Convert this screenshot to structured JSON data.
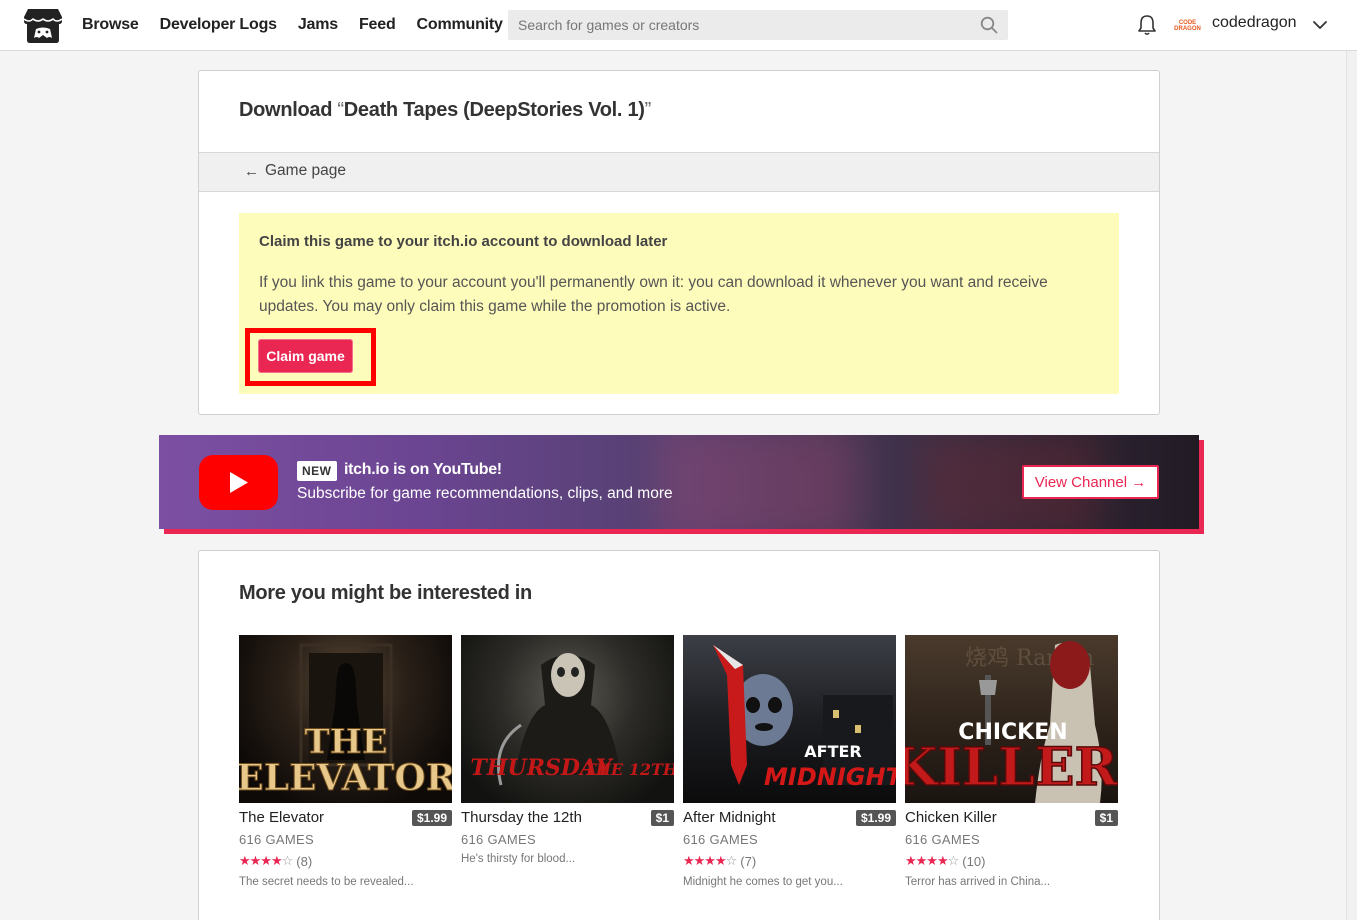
{
  "header": {
    "nav": [
      "Browse",
      "Developer Logs",
      "Jams",
      "Feed",
      "Community"
    ],
    "search_placeholder": "Search for games or creators",
    "avatar_text": "CODE DRAGON",
    "username": "codedragon"
  },
  "download": {
    "title_prefix": "Download ",
    "open_quote": "“",
    "game_name": "Death Tapes (DeepStories Vol. 1)",
    "close_quote": "”",
    "back_link": "Game page",
    "claim": {
      "title": "Claim this game to your itch.io account to download later",
      "description": "If you link this game to your account you'll permanently own it: you can download it whenever you want and receive updates. You may only claim this game while the promotion is active.",
      "button": "Claim game"
    }
  },
  "youtube_banner": {
    "badge": "NEW",
    "headline": "itch.io is on YouTube!",
    "subtitle": "Subscribe for game recommendations, clips, and more",
    "button": "View Channel →"
  },
  "recommendations": {
    "title": "More you might be interested in",
    "games": [
      {
        "title": "The Elevator",
        "price": "$1.99",
        "author": "616 GAMES",
        "rating": 4,
        "rating_count": "(8)",
        "description": "The secret needs to be revealed...",
        "thumb_text": "THE ELEVATOR"
      },
      {
        "title": "Thursday the 12th",
        "price": "$1",
        "author": "616 GAMES",
        "rating": null,
        "rating_count": "",
        "description": "He's thirsty for blood...",
        "thumb_text": "THURSDAY THE 12TH"
      },
      {
        "title": "After Midnight",
        "price": "$1.99",
        "author": "616 GAMES",
        "rating": 4,
        "rating_count": "(7)",
        "description": "Midnight he comes to get you...",
        "thumb_text": "AFTER MIDNIGHT"
      },
      {
        "title": "Chicken Killer",
        "price": "$1",
        "author": "616 GAMES",
        "rating": 4,
        "rating_count": "(10)",
        "description": "Terror has arrived in China...",
        "thumb_text": "CHICKEN KILLER"
      }
    ]
  },
  "colors": {
    "accent": "#ea2653",
    "claim_box_bg": "#fefcbb",
    "highlight_border": "#ff0000",
    "youtube_red": "#ff0000"
  }
}
